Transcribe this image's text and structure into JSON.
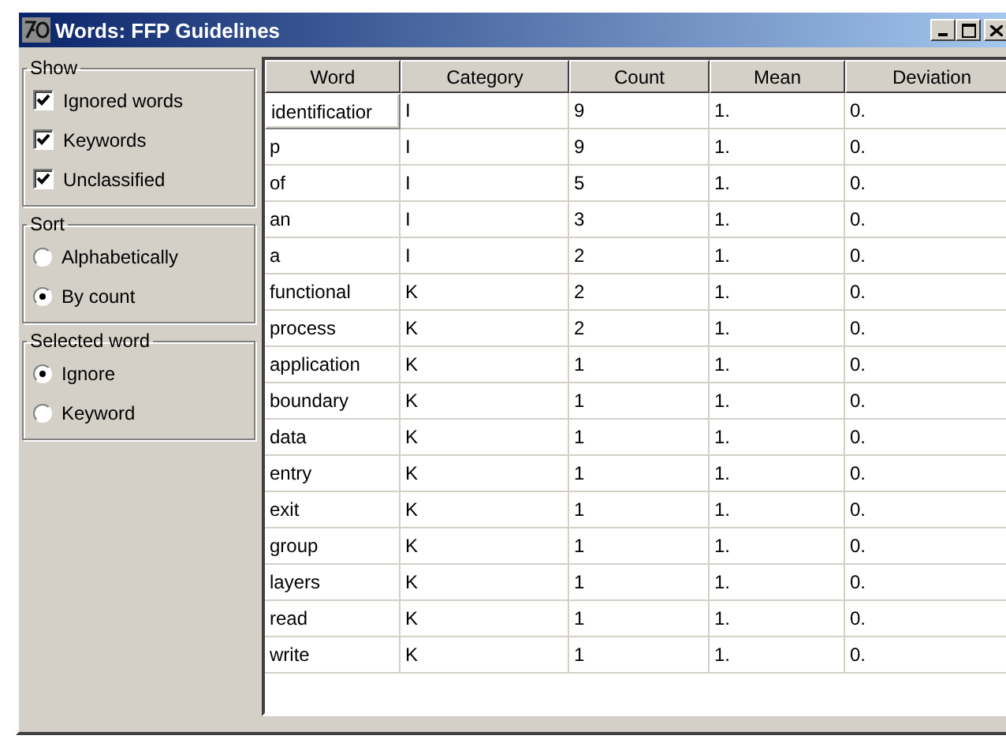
{
  "window": {
    "title": "Words: FFP Guidelines"
  },
  "show": {
    "label": "Show",
    "options": [
      {
        "label": "Ignored words",
        "checked": true
      },
      {
        "label": "Keywords",
        "checked": true
      },
      {
        "label": "Unclassified",
        "checked": true
      }
    ]
  },
  "sort": {
    "label": "Sort",
    "options": [
      {
        "label": "Alphabetically",
        "selected": false
      },
      {
        "label": "By count",
        "selected": true
      }
    ]
  },
  "selected_word": {
    "label": "Selected word",
    "options": [
      {
        "label": "Ignore",
        "selected": true
      },
      {
        "label": "Keyword",
        "selected": false
      }
    ]
  },
  "table": {
    "columns": [
      "Word",
      "Category",
      "Count",
      "Mean",
      "Deviation"
    ],
    "rows": [
      {
        "cells": [
          "identificatior",
          "I",
          "9",
          "1.",
          "0."
        ],
        "selected": true
      },
      {
        "cells": [
          "p",
          "I",
          "9",
          "1.",
          "0."
        ],
        "selected": false
      },
      {
        "cells": [
          "of",
          "I",
          "5",
          "1.",
          "0."
        ],
        "selected": false
      },
      {
        "cells": [
          "an",
          "I",
          "3",
          "1.",
          "0."
        ],
        "selected": false
      },
      {
        "cells": [
          "a",
          "I",
          "2",
          "1.",
          "0."
        ],
        "selected": false
      },
      {
        "cells": [
          "functional",
          "K",
          "2",
          "1.",
          "0."
        ],
        "selected": false
      },
      {
        "cells": [
          "process",
          "K",
          "2",
          "1.",
          "0."
        ],
        "selected": false
      },
      {
        "cells": [
          "application",
          "K",
          "1",
          "1.",
          "0."
        ],
        "selected": false
      },
      {
        "cells": [
          "boundary",
          "K",
          "1",
          "1.",
          "0."
        ],
        "selected": false
      },
      {
        "cells": [
          "data",
          "K",
          "1",
          "1.",
          "0."
        ],
        "selected": false
      },
      {
        "cells": [
          "entry",
          "K",
          "1",
          "1.",
          "0."
        ],
        "selected": false
      },
      {
        "cells": [
          "exit",
          "K",
          "1",
          "1.",
          "0."
        ],
        "selected": false
      },
      {
        "cells": [
          "group",
          "K",
          "1",
          "1.",
          "0."
        ],
        "selected": false
      },
      {
        "cells": [
          "layers",
          "K",
          "1",
          "1.",
          "0."
        ],
        "selected": false
      },
      {
        "cells": [
          "read",
          "K",
          "1",
          "1.",
          "0."
        ],
        "selected": false
      },
      {
        "cells": [
          "write",
          "K",
          "1",
          "1.",
          "0."
        ],
        "selected": false
      }
    ]
  }
}
